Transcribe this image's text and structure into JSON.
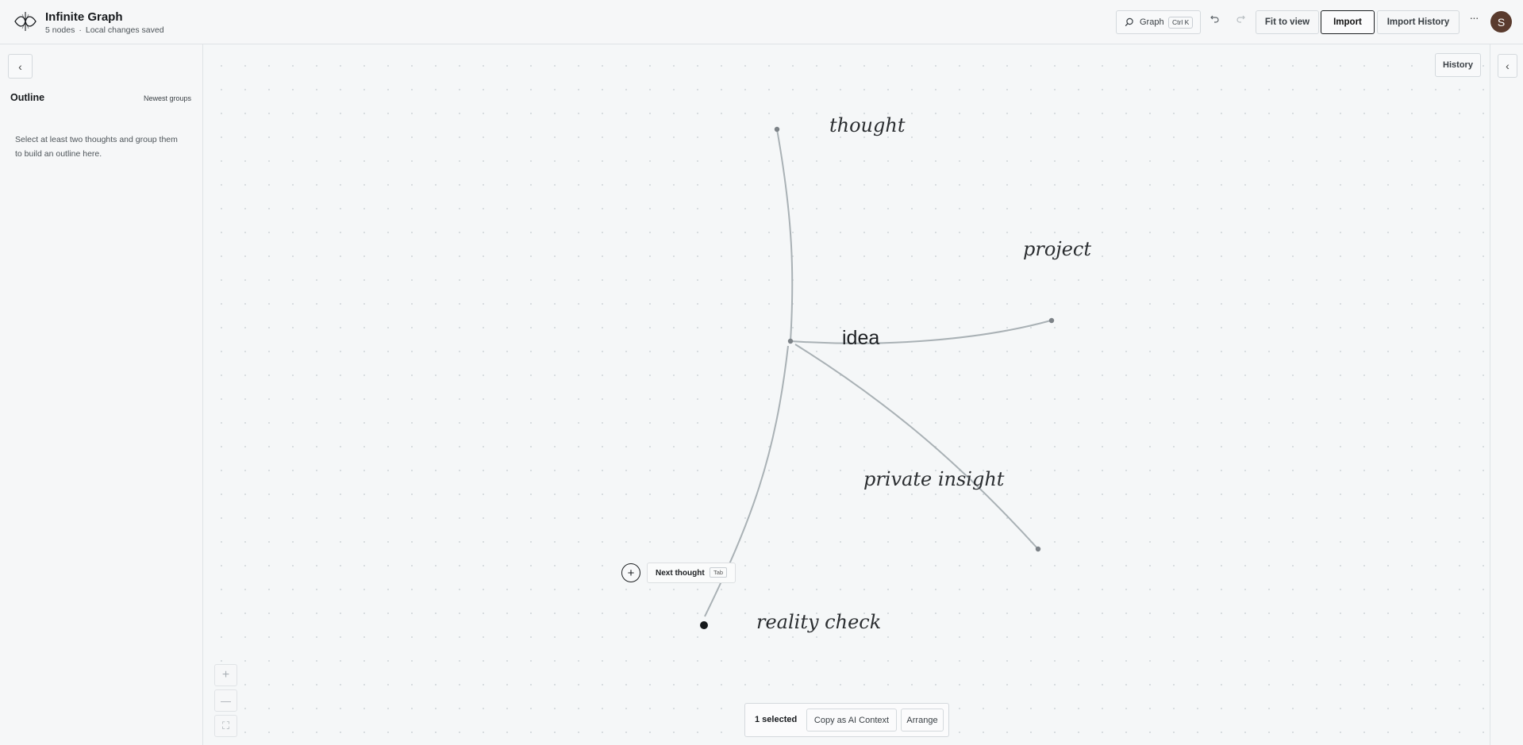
{
  "app": {
    "title": "Infinite Graph",
    "node_count": "5 nodes",
    "separator": "·",
    "save_status": "Local changes saved"
  },
  "header": {
    "search_label": "Graph",
    "search_shortcut": "Ctrl K",
    "fit_label": "Fit to view",
    "import_label": "Import",
    "import_history_label": "Import History",
    "more_label": "···",
    "avatar_initial": "S",
    "undo_icon": "undo-icon",
    "redo_icon": "redo-icon"
  },
  "sidebar": {
    "collapse_glyph": "‹",
    "title": "Outline",
    "sort_label": "Newest groups",
    "empty_message": "Select at least two thoughts and group them to build an outline here."
  },
  "right_rail": {
    "collapse_glyph": "‹",
    "history_label": "History"
  },
  "graph": {
    "root": {
      "label": "idea"
    },
    "children": [
      {
        "label": "thought"
      },
      {
        "label": "project"
      },
      {
        "label": "private insight"
      },
      {
        "label": "reality check",
        "selected": true
      }
    ],
    "edge_color": "#a9b1b5",
    "node_color": "#7c8287",
    "selected_node_color": "#16191c"
  },
  "composer": {
    "add_glyph": "+",
    "next_label": "Next thought",
    "next_shortcut": "Tab"
  },
  "zoom": {
    "in_glyph": "+",
    "out_glyph": "—",
    "fit_glyph": "⛶"
  },
  "selection": {
    "count_label": "1 selected",
    "copy_label": "Copy as AI Context",
    "arrange_label": "Arrange"
  },
  "colors": {
    "background": "#f5f7f8",
    "border": "#dfe3e6",
    "avatar": "#5a3b2e",
    "accent_border": "#1c1f22"
  }
}
